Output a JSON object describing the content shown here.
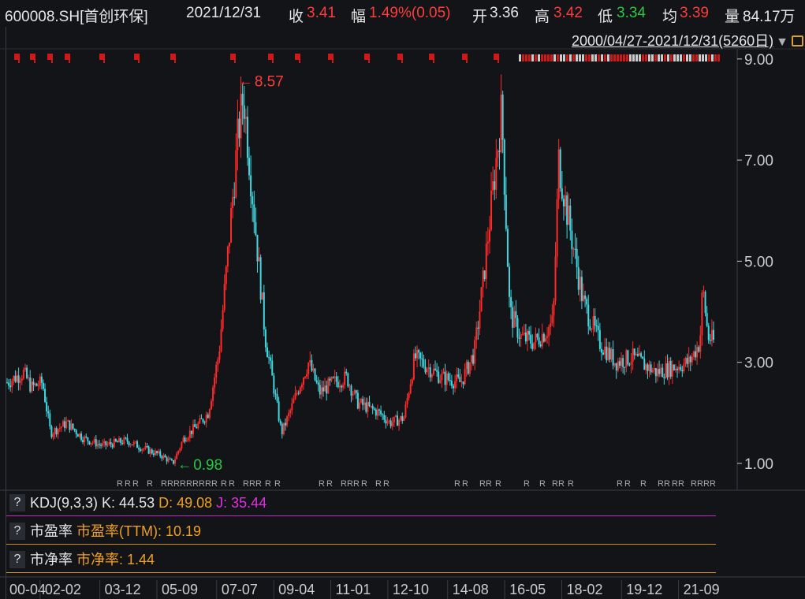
{
  "header": {
    "symbol": "600008.SH[首创环保]",
    "date": "2021/12/31",
    "close_label": "收",
    "close": "3.41",
    "change_label": "幅",
    "change": "1.49%(0.05)",
    "open_label": "开",
    "open": "3.36",
    "high_label": "高",
    "high": "3.42",
    "low_label": "低",
    "low": "3.34",
    "avg_label": "均",
    "avg": "3.39",
    "vol_label": "量",
    "vol": "84.17万"
  },
  "range": {
    "text": "2000/04/27-2021/12/31(5260日)"
  },
  "indicators": [
    {
      "name": "KDJ(9,3,3)",
      "parts": [
        {
          "text": "K: 44.53",
          "color": "#e6e6e6"
        },
        {
          "text": "D: 49.08",
          "color": "#f0a020"
        },
        {
          "text": "J: 35.44",
          "color": "#e030e0"
        }
      ],
      "line_color": "#c030c0"
    },
    {
      "name": "市盈率",
      "parts": [
        {
          "text": "市盈率(TTM): 10.19",
          "color": "#f0a020"
        }
      ],
      "line_color": "#d08a20"
    },
    {
      "name": "市净率",
      "parts": [
        {
          "text": "市净率: 1.44",
          "color": "#f0a020"
        }
      ],
      "line_color": "#d08a20"
    }
  ],
  "colors": {
    "up": "#ff2a2a",
    "down": "#40d8e0",
    "hi": "#ff3c3c",
    "lo": "#29c840",
    "axis": "#cccccc"
  },
  "chart_data": {
    "type": "candlestick",
    "y_ticks": [
      "9.00",
      "7.00",
      "5.00",
      "3.00",
      "1.00"
    ],
    "y_tick_values": [
      9,
      7,
      5,
      3,
      1
    ],
    "ylim": [
      0.5,
      9.2
    ],
    "x_ticks": [
      "00-04",
      "02-02",
      "03-12",
      "05-09",
      "07-07",
      "09-04",
      "11-01",
      "12-10",
      "14-08",
      "16-05",
      "18-02",
      "19-12",
      "21-09"
    ],
    "high_annotation": {
      "text": "8.57",
      "value": 8.57,
      "date": "2007-07"
    },
    "low_annotation": {
      "text": "0.98",
      "value": 0.98,
      "date": "2005-05"
    },
    "price_path": [
      [
        "2000-04",
        2.6
      ],
      [
        "2000-10",
        2.8
      ],
      [
        "2001-01",
        2.5
      ],
      [
        "2001-05",
        2.6
      ],
      [
        "2001-08",
        1.6
      ],
      [
        "2002-02",
        1.8
      ],
      [
        "2002-08",
        1.5
      ],
      [
        "2003-03",
        1.35
      ],
      [
        "2003-12",
        1.45
      ],
      [
        "2004-06",
        1.3
      ],
      [
        "2005-01",
        1.15
      ],
      [
        "2005-05",
        1.0
      ],
      [
        "2005-09",
        1.5
      ],
      [
        "2006-03",
        1.8
      ],
      [
        "2006-06",
        2.0
      ],
      [
        "2006-10",
        3.2
      ],
      [
        "2007-01",
        5.0
      ],
      [
        "2007-05",
        7.5
      ],
      [
        "2007-07",
        8.3
      ],
      [
        "2007-10",
        6.5
      ],
      [
        "2008-03",
        3.5
      ],
      [
        "2008-09",
        1.6
      ],
      [
        "2008-12",
        2.0
      ],
      [
        "2009-04",
        2.6
      ],
      [
        "2009-07",
        3.0
      ],
      [
        "2009-11",
        2.4
      ],
      [
        "2010-04",
        2.6
      ],
      [
        "2010-09",
        2.7
      ],
      [
        "2011-01",
        2.2
      ],
      [
        "2011-09",
        2.0
      ],
      [
        "2012-01",
        1.8
      ],
      [
        "2012-06",
        1.9
      ],
      [
        "2012-10",
        3.1
      ],
      [
        "2013-03",
        2.9
      ],
      [
        "2013-08",
        2.7
      ],
      [
        "2014-03",
        2.6
      ],
      [
        "2014-08",
        3.2
      ],
      [
        "2014-11",
        4.5
      ],
      [
        "2015-03",
        6.5
      ],
      [
        "2015-06",
        8.0
      ],
      [
        "2015-09",
        4.0
      ],
      [
        "2016-01",
        3.5
      ],
      [
        "2016-06",
        3.4
      ],
      [
        "2016-10",
        3.6
      ],
      [
        "2017-01",
        3.8
      ],
      [
        "2017-03",
        7.0
      ],
      [
        "2017-06",
        6.0
      ],
      [
        "2017-12",
        4.2
      ],
      [
        "2018-06",
        3.4
      ],
      [
        "2018-12",
        3.0
      ],
      [
        "2019-06",
        3.1
      ],
      [
        "2020-03",
        2.8
      ],
      [
        "2020-09",
        2.9
      ],
      [
        "2021-03",
        3.0
      ],
      [
        "2021-07",
        3.4
      ],
      [
        "2021-08",
        4.5
      ],
      [
        "2021-10",
        3.5
      ],
      [
        "2021-12",
        3.41
      ]
    ]
  }
}
